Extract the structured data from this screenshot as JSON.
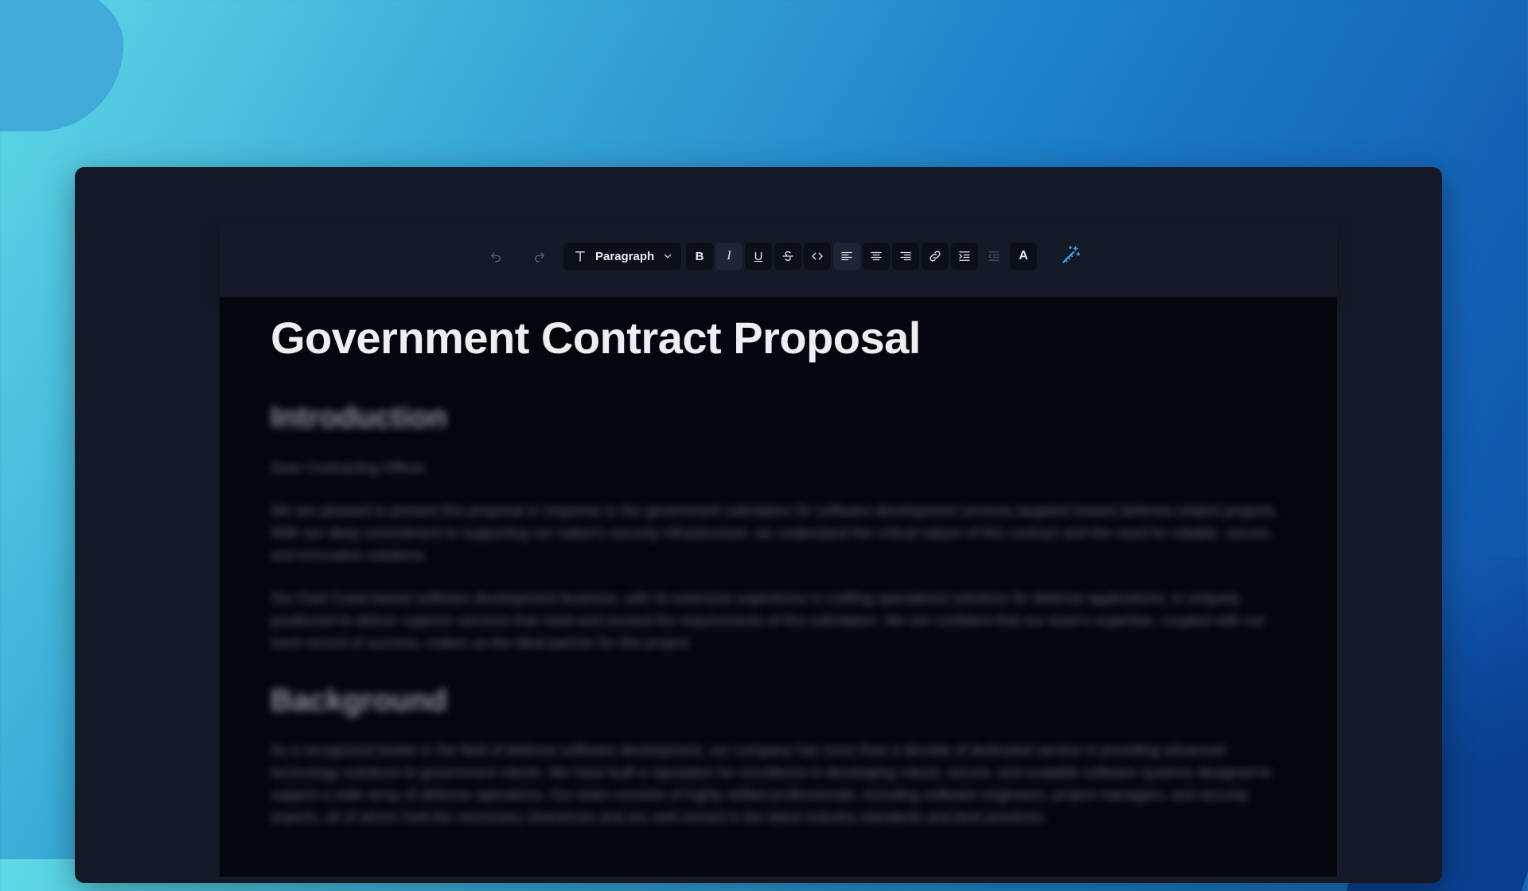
{
  "toolbar": {
    "undo_icon": "undo-icon",
    "redo_icon": "redo-icon",
    "block_type": "Paragraph",
    "buttons": [
      "bold-icon",
      "italic-icon",
      "underline-icon",
      "strikethrough-icon",
      "code-icon",
      "align-left-icon",
      "align-center-icon",
      "align-right-icon",
      "link-icon",
      "indent-icon",
      "outdent-icon",
      "text-color-icon",
      "magic-wand-icon"
    ],
    "bold_glyph": "B",
    "italic_glyph": "I",
    "underline_glyph": "U",
    "text_color_glyph": "A",
    "accent_color": "#3b9cf0"
  },
  "document": {
    "title": "Government Contract Proposal",
    "section1_heading": "Introduction",
    "salutation": "Dear Contracting Officer,",
    "para1": "We are pleased to present this proposal in response to the government solicitation for software development services targeted toward defense-related projects. With our deep commitment to supporting our nation's security infrastructure, we understand the critical nature of this contract and the need for reliable, secure, and innovative solutions.",
    "para2": "Our East Coast-based software development business, with its extensive experience in crafting specialized solutions for defense applications, is uniquely positioned to deliver superior services that meet and exceed the requirements of this solicitation. We are confident that our team's expertise, coupled with our track record of success, makes us the ideal partner for this project.",
    "section2_heading": "Background",
    "para3": "As a recognized leader in the field of defense software development, our company has more than a decade of dedicated service in providing advanced technology solutions to government clients. We have built a reputation for excellence in developing robust, secure, and scalable software systems designed to support a wide array of defense operations. Our team consists of highly skilled professionals, including software engineers, project managers, and security experts, all of whom hold the necessary clearances and are well-versed in the latest industry standards and best practices."
  }
}
